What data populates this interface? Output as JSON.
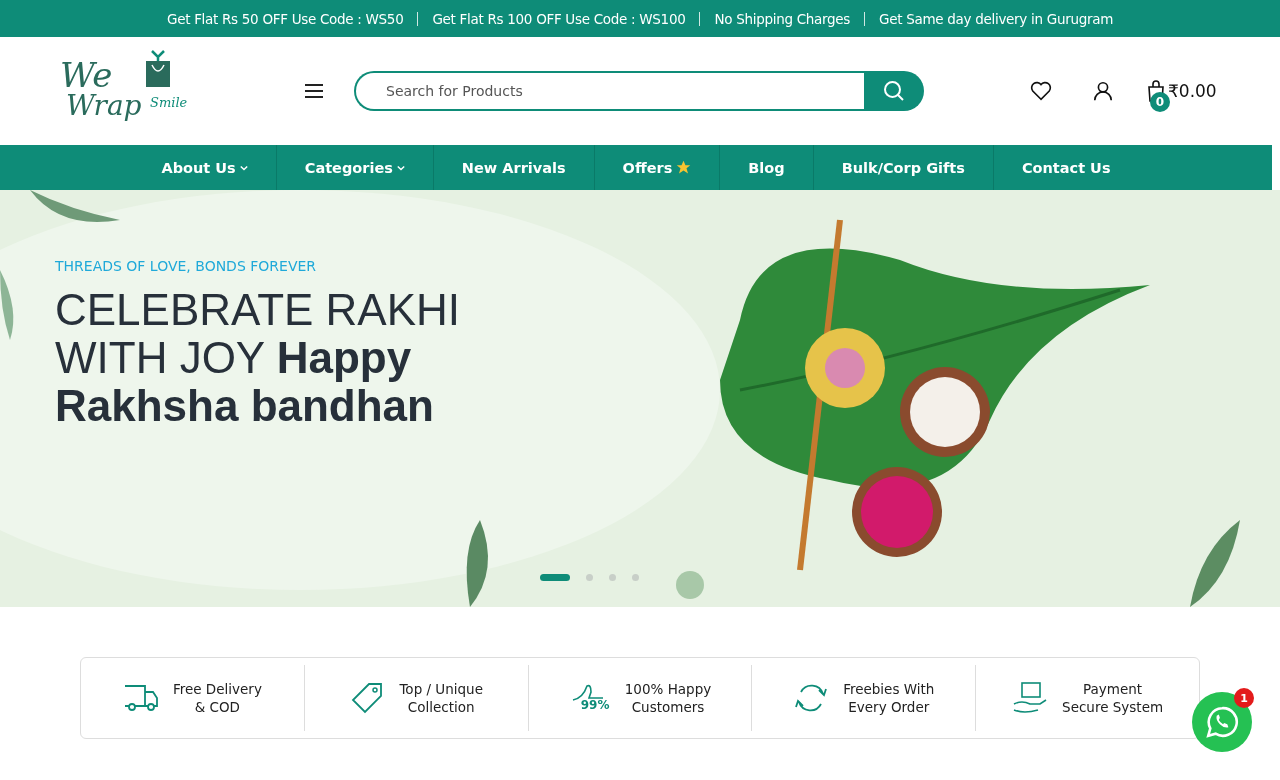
{
  "announcements": [
    "Get Flat Rs 50 OFF Use Code : WS50",
    "Get Flat Rs 100 OFF Use Code : WS100",
    "No Shipping Charges",
    "Get Same day delivery in Gurugram"
  ],
  "logo": {
    "line1": "We",
    "line2": "Wrap",
    "tagline": "Smile"
  },
  "search": {
    "placeholder": "Search for Products"
  },
  "cart": {
    "count": "0",
    "total": "₹0.00"
  },
  "nav": [
    {
      "label": "About Us",
      "dropdown": true,
      "star": false
    },
    {
      "label": "Categories",
      "dropdown": true,
      "star": false
    },
    {
      "label": "New Arrivals",
      "dropdown": false,
      "star": false
    },
    {
      "label": "Offers",
      "dropdown": false,
      "star": true
    },
    {
      "label": "Blog",
      "dropdown": false,
      "star": false
    },
    {
      "label": "Bulk/Corp Gifts",
      "dropdown": false,
      "star": false
    },
    {
      "label": "Contact Us",
      "dropdown": false,
      "star": false
    }
  ],
  "hero": {
    "kind": "picture",
    "eyebrow": "THREADS OF LOVE, BONDS FOREVER",
    "title": "CELEBRATE RAKHI WITH JOY **Happy Rakhsha bandhan**",
    "dots": [
      {
        "selected": true
      },
      {
        "selected": false
      },
      {
        "selected": false
      },
      {
        "selected": false
      }
    ]
  },
  "features": [
    {
      "kind": "truck",
      "title": "Free Delivery",
      "subtitle": "& COD"
    },
    {
      "kind": "tag",
      "title": "Top / Unique",
      "subtitle": "Collection"
    },
    {
      "kind": "thumb",
      "icon_label": "99%",
      "title": "100% Happy",
      "subtitle": "Customers"
    },
    {
      "kind": "cycle",
      "title": "Freebies With",
      "subtitle": "Every Order"
    },
    {
      "kind": "payment",
      "title": "Payment",
      "subtitle": "Secure System"
    }
  ],
  "chat": {
    "badge": "1"
  }
}
